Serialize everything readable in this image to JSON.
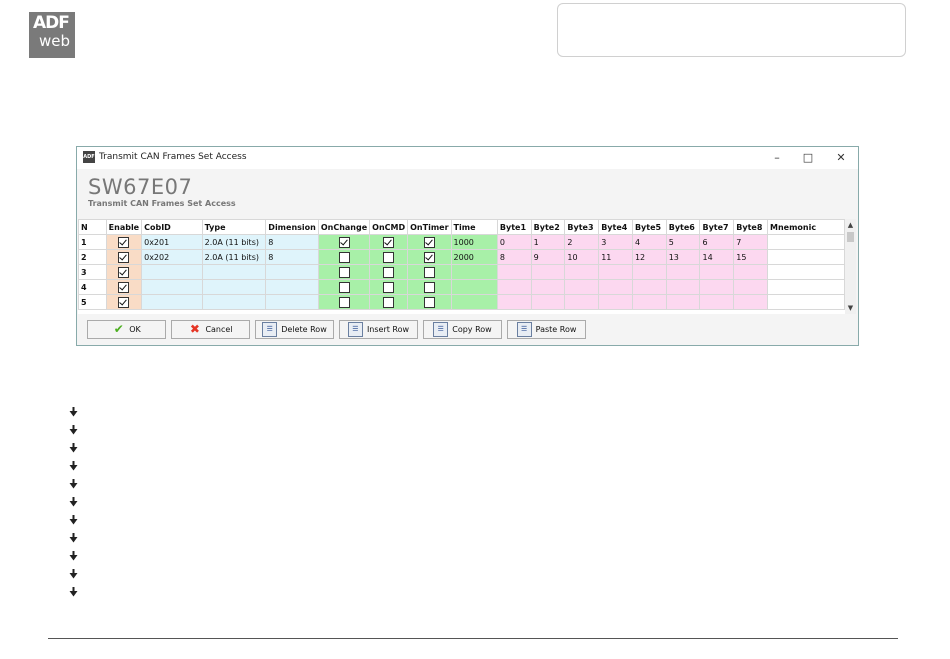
{
  "logo": {
    "line1": "ADF",
    "line2": "web"
  },
  "window": {
    "title": "Transmit CAN Frames Set Access",
    "app_title": "SW67E07",
    "app_subtitle": "Transmit CAN Frames Set Access"
  },
  "table": {
    "headers": [
      "N",
      "Enable",
      "CobID",
      "Type",
      "Dimension",
      "OnChange",
      "OnCMD",
      "OnTimer",
      "Time",
      "Byte1",
      "Byte2",
      "Byte3",
      "Byte4",
      "Byte5",
      "Byte6",
      "Byte7",
      "Byte8",
      "Mnemonic"
    ],
    "rows": [
      {
        "n": "1",
        "enable": true,
        "cobid": "0x201",
        "type": "2.0A (11 bits)",
        "dimension": "8",
        "onchange": true,
        "oncmd": true,
        "ontimer": true,
        "time": "1000",
        "bytes": [
          "0",
          "1",
          "2",
          "3",
          "4",
          "5",
          "6",
          "7"
        ],
        "mnemonic": ""
      },
      {
        "n": "2",
        "enable": true,
        "cobid": "0x202",
        "type": "2.0A (11 bits)",
        "dimension": "8",
        "onchange": false,
        "oncmd": false,
        "ontimer": true,
        "time": "2000",
        "bytes": [
          "8",
          "9",
          "10",
          "11",
          "12",
          "13",
          "14",
          "15"
        ],
        "mnemonic": ""
      },
      {
        "n": "3",
        "enable": true,
        "cobid": "",
        "type": "",
        "dimension": "",
        "onchange": false,
        "oncmd": false,
        "ontimer": false,
        "time": "",
        "bytes": [
          "",
          "",
          "",
          "",
          "",
          "",
          "",
          ""
        ],
        "mnemonic": ""
      },
      {
        "n": "4",
        "enable": true,
        "cobid": "",
        "type": "",
        "dimension": "",
        "onchange": false,
        "oncmd": false,
        "ontimer": false,
        "time": "",
        "bytes": [
          "",
          "",
          "",
          "",
          "",
          "",
          "",
          ""
        ],
        "mnemonic": ""
      },
      {
        "n": "5",
        "enable": true,
        "cobid": "",
        "type": "",
        "dimension": "",
        "onchange": false,
        "oncmd": false,
        "ontimer": false,
        "time": "",
        "bytes": [
          "",
          "",
          "",
          "",
          "",
          "",
          "",
          ""
        ],
        "mnemonic": ""
      }
    ]
  },
  "buttons": {
    "ok": "OK",
    "cancel": "Cancel",
    "delete_row": "Delete Row",
    "insert_row": "Insert Row",
    "copy_row": "Copy Row",
    "paste_row": "Paste Row"
  },
  "icons": {
    "ok": "checkmark-icon",
    "cancel": "red-x-icon",
    "row_ops": "document-icon",
    "bullets": "arrow-bullet-icon"
  },
  "colors": {
    "enable_col": "#f9dcc6",
    "frame_cols": "#dff4fb",
    "trigger_cols": "#a8f0a8",
    "byte_cols": "#fcd8f0"
  }
}
